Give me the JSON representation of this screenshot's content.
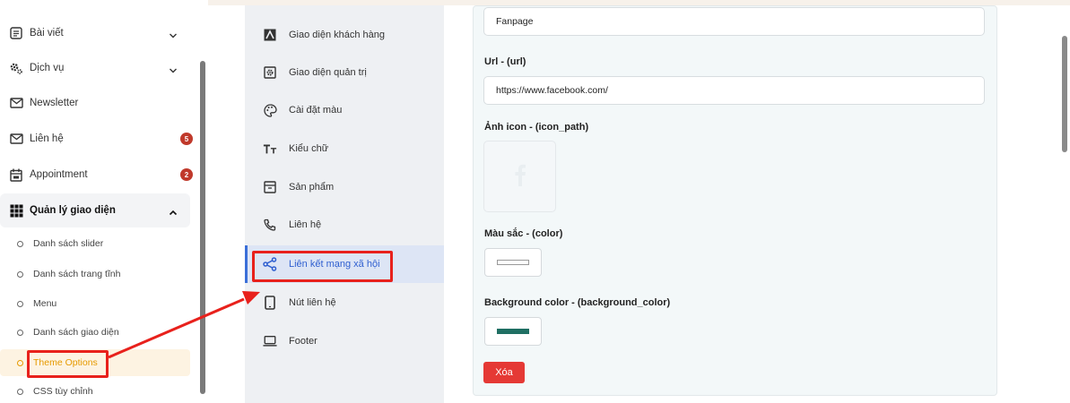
{
  "sidebar": {
    "items": [
      {
        "label": "Bài viết",
        "icon": "article-icon",
        "chevron": true
      },
      {
        "label": "Dịch vụ",
        "icon": "gears-icon",
        "chevron": true
      },
      {
        "label": "Newsletter",
        "icon": "mail-icon"
      },
      {
        "label": "Liên hệ",
        "icon": "mail-icon",
        "badge": "5"
      },
      {
        "label": "Appointment",
        "icon": "calendar-icon",
        "badge": "2"
      },
      {
        "label": "Quản lý giao diện",
        "icon": "grid-icon",
        "chevron": true,
        "expanded": true
      }
    ],
    "subitems": [
      {
        "label": "Danh sách slider"
      },
      {
        "label": "Danh sách trang tĩnh"
      },
      {
        "label": "Menu"
      },
      {
        "label": "Danh sách giao diện"
      },
      {
        "label": "Theme Options",
        "current": true
      },
      {
        "label": "CSS tùy chỉnh"
      }
    ]
  },
  "tabs": [
    {
      "label": "Giao diện khách hàng",
      "icon": "customer-ui-icon"
    },
    {
      "label": "Giao diện quản trị",
      "icon": "admin-ui-icon"
    },
    {
      "label": "Cài đặt màu",
      "icon": "palette-icon"
    },
    {
      "label": "Kiểu chữ",
      "icon": "typography-icon"
    },
    {
      "label": "Sản phẩm",
      "icon": "archive-icon"
    },
    {
      "label": "Liên hệ",
      "icon": "phone-icon"
    },
    {
      "label": "Liên kết mạng xã hội",
      "icon": "share-icon",
      "active": true
    },
    {
      "label": "Nút liên hệ",
      "icon": "mobile-icon"
    },
    {
      "label": "Footer",
      "icon": "laptop-icon"
    }
  ],
  "form": {
    "name_value": "Fanpage",
    "url_label": "Url - (url)",
    "url_value": "https://www.facebook.com/",
    "icon_label": "Ảnh icon - (icon_path)",
    "color_label": "Màu sắc - (color)",
    "color_value": "#ffffff",
    "bg_label": "Background color - (background_color)",
    "bg_value": "#1f6f63",
    "delete_label": "Xóa"
  },
  "colors": {
    "accent": "#3b6fd8",
    "highlight": "#e8211c",
    "danger": "#e53935",
    "badge": "#c0392b",
    "current": "#e69a00"
  }
}
